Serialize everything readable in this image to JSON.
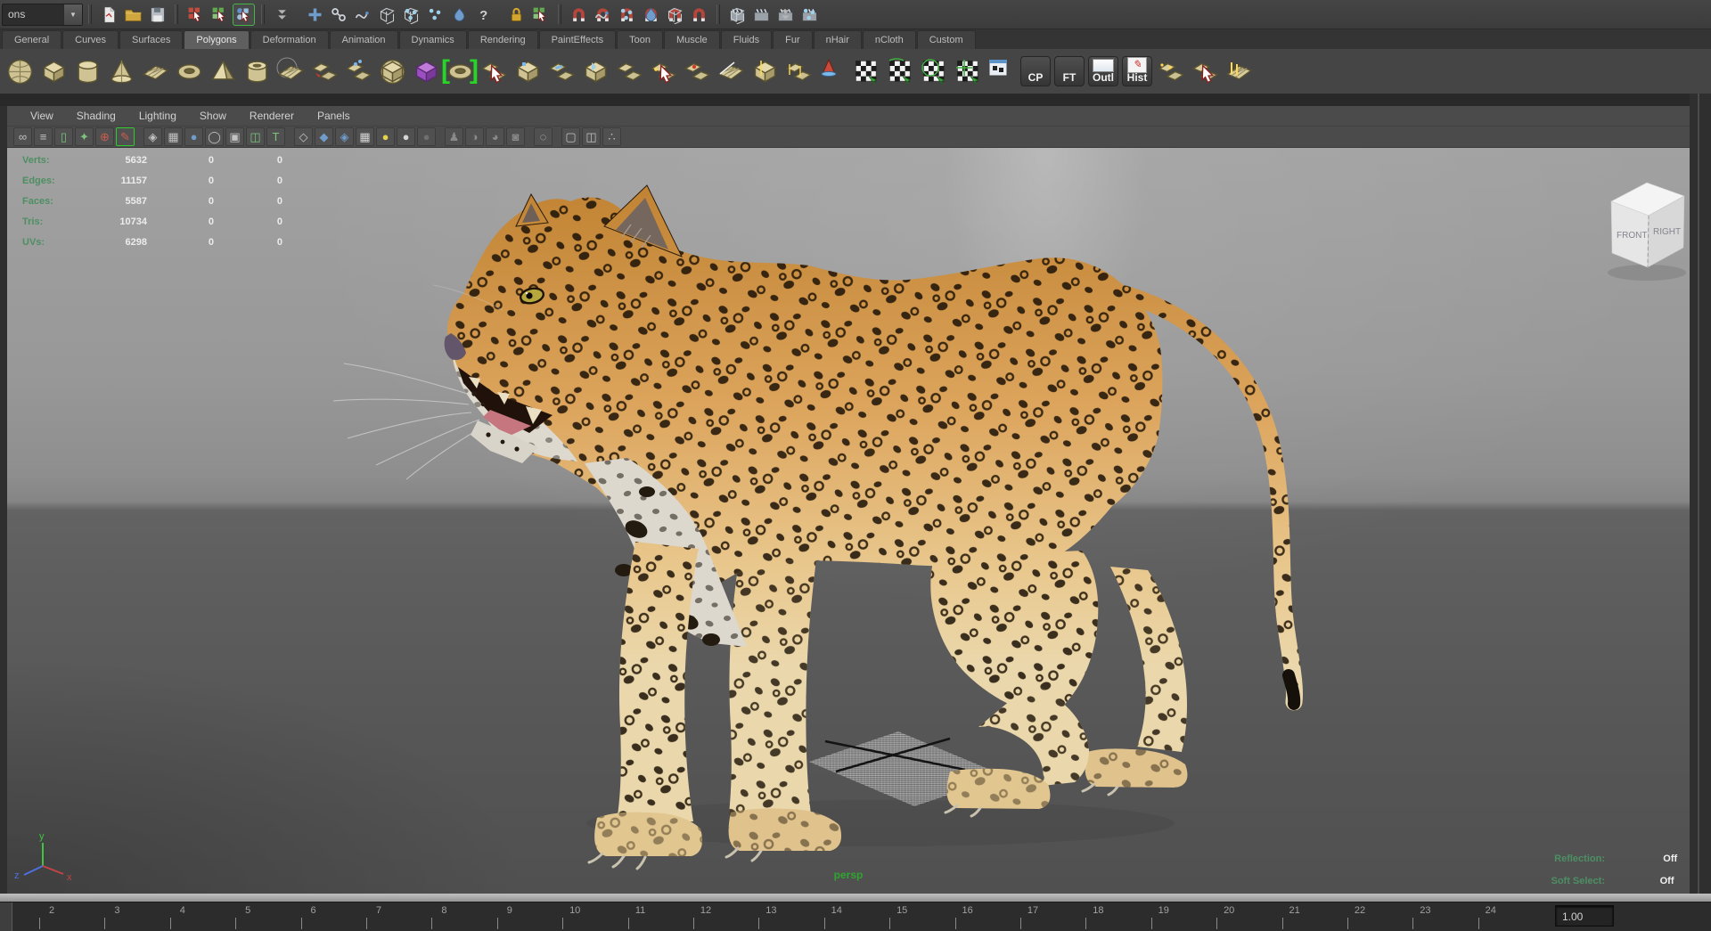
{
  "status_bar": {
    "menu_set_value": "ons",
    "dropdown_arrow": "▼",
    "icons": [
      "new-scene",
      "open-scene",
      "save-scene",
      "select-hierarchy",
      "select-object",
      "select-component",
      "snap-modes",
      "move-tool",
      "ik-handle",
      "curve-snap",
      "lattice",
      "cluster",
      "particles",
      "fluid",
      "help",
      "lock-selection",
      "highlight-selection",
      "snap-grid",
      "snap-curve",
      "snap-point",
      "snap-projected-center",
      "snap-view-plane",
      "make-live",
      "open-render-view",
      "render-current-frame",
      "ipr-render",
      "render-settings"
    ]
  },
  "shelf": {
    "tabs": [
      "General",
      "Curves",
      "Surfaces",
      "Polygons",
      "Deformation",
      "Animation",
      "Dynamics",
      "Rendering",
      "PaintEffects",
      "Toon",
      "Muscle",
      "Fluids",
      "Fur",
      "nHair",
      "nCloth",
      "Custom"
    ],
    "active_tab": "Polygons",
    "buttons": {
      "cp": "CP",
      "ft": "FT",
      "outl": "Outl",
      "hist": "Hist"
    }
  },
  "panel": {
    "menu": [
      "View",
      "Shading",
      "Lighting",
      "Show",
      "Renderer",
      "Panels"
    ],
    "toolbar_icons": [
      {
        "n": "select-camera-icon",
        "g": "∞"
      },
      {
        "n": "camera-attributes-icon",
        "g": "≡"
      },
      {
        "n": "bookmark-icon",
        "g": "▯"
      },
      {
        "n": "image-plane-icon",
        "g": "✦"
      },
      {
        "n": "2d-pan-zoom-icon",
        "g": "⊕"
      },
      {
        "n": "grease-pencil-icon",
        "g": "✎"
      },
      {
        "n": "film-gate-icon",
        "g": "◈"
      },
      {
        "n": "resolution-gate-icon",
        "g": "▦"
      },
      {
        "n": "gate-mask-icon",
        "g": "●"
      },
      {
        "n": "field-chart-icon",
        "g": "◯"
      },
      {
        "n": "safe-action-icon",
        "g": "▣"
      },
      {
        "n": "safe-title-icon",
        "g": "◫"
      },
      {
        "n": "hud-text-icon",
        "g": "T"
      },
      {
        "n": "wireframe-icon",
        "g": "◇"
      },
      {
        "n": "shaded-icon",
        "g": "◆"
      },
      {
        "n": "textured-icon",
        "g": "◈"
      },
      {
        "n": "checkered-icon",
        "g": "▦"
      },
      {
        "n": "use-all-lights-icon",
        "g": "●"
      },
      {
        "n": "shadows-icon",
        "g": "●"
      },
      {
        "n": "ambient-occlusion-icon",
        "g": "●"
      },
      {
        "n": "xray-icon",
        "g": "♟"
      },
      {
        "n": "xray-joints-icon",
        "g": "◑"
      },
      {
        "n": "xray-active-icon",
        "g": "◕"
      },
      {
        "n": "plugin-shading-icon",
        "g": "◙"
      },
      {
        "n": "isolate-select-icon",
        "g": "◌"
      },
      {
        "n": "scene-shapes-icon",
        "g": "▢"
      },
      {
        "n": "panel-layout-icon",
        "g": "◫"
      },
      {
        "n": "share-view-icon",
        "g": "∴"
      }
    ]
  },
  "hud": {
    "rows": [
      {
        "label": "Verts:",
        "v1": "5632",
        "v2": "0",
        "v3": "0"
      },
      {
        "label": "Edges:",
        "v1": "11157",
        "v2": "0",
        "v3": "0"
      },
      {
        "label": "Faces:",
        "v1": "5587",
        "v2": "0",
        "v3": "0"
      },
      {
        "label": "Tris:",
        "v1": "10734",
        "v2": "0",
        "v3": "0"
      },
      {
        "label": "UVs:",
        "v1": "6298",
        "v2": "0",
        "v3": "0"
      }
    ]
  },
  "viewport": {
    "camera_label": "persp",
    "view_cube": {
      "front": "FRONT",
      "right": "RIGHT"
    },
    "axis": {
      "x": "x",
      "y": "y",
      "z": "z"
    },
    "reflection_label": "Reflection:",
    "reflection_value": "Off",
    "soft_select_label": "Soft Select:",
    "soft_select_value": "Off"
  },
  "timeline": {
    "ticks": [
      "2",
      "3",
      "4",
      "5",
      "6",
      "7",
      "8",
      "9",
      "10",
      "11",
      "12",
      "13",
      "14",
      "15",
      "16",
      "17",
      "18",
      "19",
      "20",
      "21",
      "22",
      "23",
      "24"
    ],
    "current_time": "1.00"
  },
  "colors": {
    "hud_green": "#4d8f63",
    "persp_green": "#2fa52f",
    "viewport_top": "#a1a1a1",
    "viewport_floor": "#565656",
    "coat_orange": "#dca45c",
    "spot_black": "#1b1106",
    "accent_green": "#27d427"
  }
}
